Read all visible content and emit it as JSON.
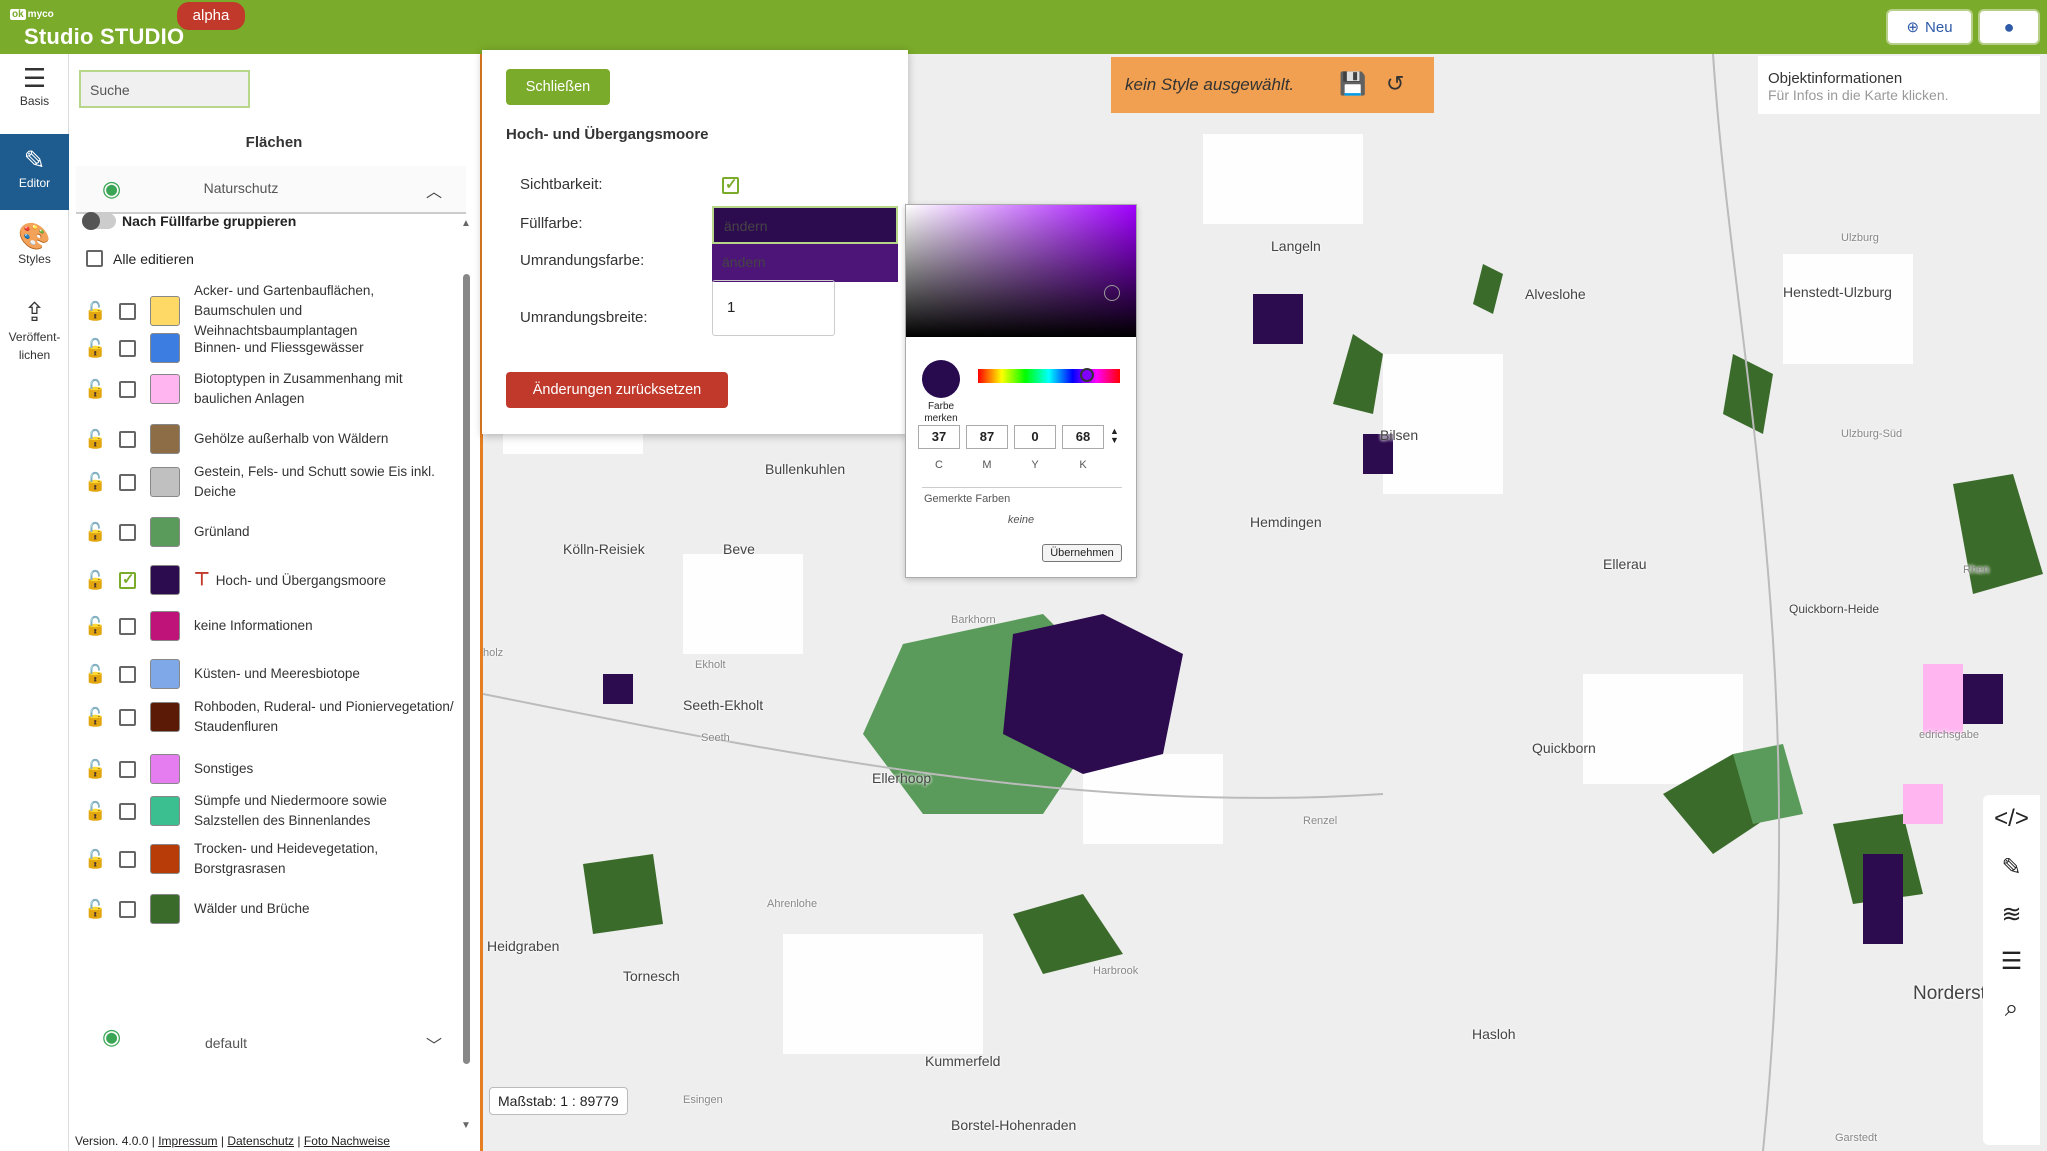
{
  "header": {
    "brand_small": "myco",
    "brand_small_box": "ok",
    "brand": "Studio STUDIO",
    "badge": "alpha",
    "new_label": "Neu",
    "accent": "#7bab2a"
  },
  "rail": [
    {
      "label": "Basis",
      "icon": "menu-icon"
    },
    {
      "label": "Editor",
      "icon": "edit-icon"
    },
    {
      "label": "Styles",
      "icon": "palette-icon"
    },
    {
      "label": "Veröffent-lichen",
      "icon": "upload-icon"
    }
  ],
  "sidebar": {
    "search_placeholder": "Suche",
    "section_title": "Flächen",
    "group_title": "Naturschutz",
    "group_toggle_label": "Nach Füllfarbe gruppieren",
    "all_edit_label": "Alle editieren",
    "layers": [
      {
        "label": "Acker- und Gartenbauflächen, Baumschulen und Weihnachtsbaumplantagen",
        "color": "#ffd966",
        "checked": false
      },
      {
        "label": "Binnen- und Fliessgewässer",
        "color": "#3b7de0",
        "checked": false
      },
      {
        "label": "Biotoptypen in Zusammenhang mit baulichen Anlagen",
        "color": "#ffb6f0",
        "checked": false
      },
      {
        "label": "Gehölze außerhalb von Wäldern",
        "color": "#8c6d46",
        "checked": false
      },
      {
        "label": "Gestein, Fels- und Schutt sowie Eis inkl. Deiche",
        "color": "#c0c0c0",
        "checked": false
      },
      {
        "label": "Grünland",
        "color": "#5a9a5a",
        "checked": false
      },
      {
        "label": "Hoch- und Übergangsmoore",
        "color": "#2d0b4f",
        "checked": true
      },
      {
        "label": "keine Informationen",
        "color": "#c0137a",
        "checked": false
      },
      {
        "label": "Küsten- und Meeresbiotope",
        "color": "#7ea8e8",
        "checked": false
      },
      {
        "label": "Rohboden, Ruderal- und Pioniervegetation/ Staudenfluren",
        "color": "#5a1a06",
        "checked": false
      },
      {
        "label": "Sonstiges",
        "color": "#e57cf0",
        "checked": false
      },
      {
        "label": "Sümpfe und Niedermoore sowie Salzstellen des Binnenlandes",
        "color": "#3cbf90",
        "checked": false
      },
      {
        "label": "Trocken- und Heidevegetation, Borstgrasrasen",
        "color": "#b83c08",
        "checked": false
      },
      {
        "label": "Wälder und Brüche",
        "color": "#3b6b2a",
        "checked": false
      }
    ],
    "default_label": "default"
  },
  "footer": {
    "version": "Version. 4.0.0 |",
    "impressum": "Impressum",
    "sep1": "|",
    "datenschutz": "Datenschutz",
    "sep2": "|",
    "foto": "Foto Nachweise"
  },
  "editor": {
    "close_label": "Schließen",
    "title": "Hoch- und Übergangsmoore",
    "visibility_label": "Sichtbarkeit:",
    "fill_label": "Füllfarbe:",
    "fill_value": "ändern",
    "stroke_label": "Umrandungsfarbe:",
    "stroke_value": "ändern",
    "stroke_width_label": "Umrandungsbreite:",
    "stroke_width_value": "1",
    "reset_label": "Änderungen zurücksetzen"
  },
  "picker": {
    "merken_label": "Farbe merken",
    "c": "37",
    "m": "87",
    "y": "0",
    "k": "68",
    "c_label": "C",
    "m_label": "M",
    "y_label": "Y",
    "k_label": "K",
    "gemerkte_label": "Gemerkte Farben",
    "keine_label": "keine",
    "apply_label": "Übernehmen"
  },
  "style_banner": {
    "text": "kein Style ausgewählt."
  },
  "objinfo": {
    "title": "Objektinformationen",
    "subtitle": "Für Infos in die Karte klicken."
  },
  "map": {
    "scale": "Maßstab: 1 : 89779",
    "places": [
      "Langeln",
      "Alveslohe",
      "Henstedt-Ulzburg",
      "Bullenkuhlen",
      "Bilsen",
      "Hemdingen",
      "Kölln-Reisiek",
      "Beve",
      "Ellerau",
      "Quickborn-Heide",
      "Barkhorn",
      "Seeth-Ekholt",
      "Ellerhoop",
      "Quickborn",
      "Renzel",
      "Ahrenlohe",
      "Heidgraben",
      "Tornesch",
      "Harbrook",
      "Hasloh",
      "Kummerfeld",
      "Norderst",
      "Borstel-Hohenraden",
      "Esingen",
      "Garstedt",
      "holz",
      "Ekholt",
      "Seeth",
      "edrichsgabe",
      "Ulzburg",
      "Ulzburg-Süd",
      "Rhen"
    ]
  }
}
